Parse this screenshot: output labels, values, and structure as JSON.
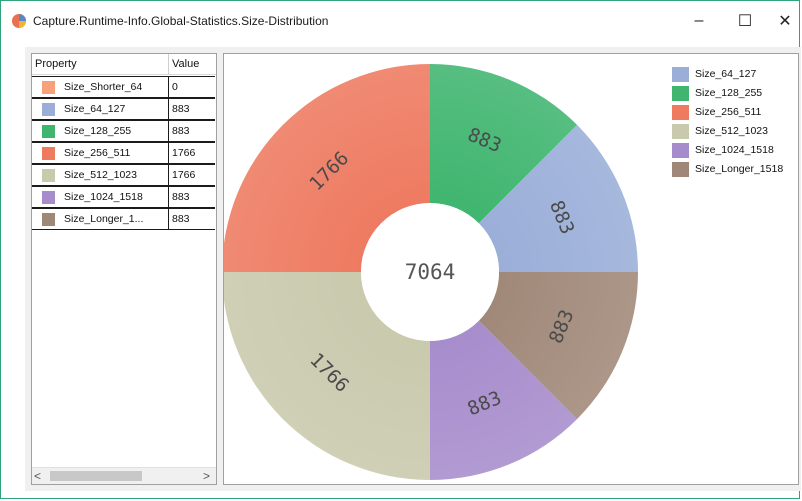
{
  "window": {
    "title": "Capture.Runtime-Info.Global-Statistics.Size-Distribution",
    "minimize_glyph": "–",
    "maximize_glyph": "☐",
    "close_glyph": "✕",
    "app_icon": "pie-chart-icon"
  },
  "grid": {
    "header_property": "Property",
    "header_value": "Value",
    "rows": [
      {
        "name": "Size_Shorter_64",
        "value": "0",
        "color": "#f7a07c"
      },
      {
        "name": "Size_64_127",
        "value": "883",
        "color": "#9aaed8"
      },
      {
        "name": "Size_128_255",
        "value": "883",
        "color": "#3fb56f"
      },
      {
        "name": "Size_256_511",
        "value": "1766",
        "color": "#ee7a60"
      },
      {
        "name": "Size_512_1023",
        "value": "1766",
        "color": "#c9c9ad"
      },
      {
        "name": "Size_1024_1518",
        "value": "883",
        "color": "#a78ccc"
      },
      {
        "name": "Size_Longer_1...",
        "value": "883",
        "color": "#a08878"
      }
    ],
    "scroll_left": "<",
    "scroll_right": ">"
  },
  "chart_data": {
    "type": "pie",
    "donut": true,
    "center_label": "7064",
    "start": "top, clockwise",
    "slices": [
      {
        "label": "Size_128_255",
        "value": 883,
        "color": "#3fb56f"
      },
      {
        "label": "Size_64_127",
        "value": 883,
        "color": "#9aaed8"
      },
      {
        "label": "Size_Longer_1518",
        "value": 883,
        "color": "#a08878"
      },
      {
        "label": "Size_1024_1518",
        "value": 883,
        "color": "#a78ccc"
      },
      {
        "label": "Size_512_1023",
        "value": 1766,
        "color": "#c9c9ad"
      },
      {
        "label": "Size_256_511",
        "value": 1766,
        "color": "#ee7a60"
      }
    ],
    "legend_placement": "top-right",
    "legend": [
      {
        "label": "Size_64_127",
        "color": "#9aaed8"
      },
      {
        "label": "Size_128_255",
        "color": "#3fb56f"
      },
      {
        "label": "Size_256_511",
        "color": "#ee7a60"
      },
      {
        "label": "Size_512_1023",
        "color": "#c9c9ad"
      },
      {
        "label": "Size_1024_1518",
        "color": "#a78ccc"
      },
      {
        "label": "Size_Longer_1518",
        "color": "#a08878"
      }
    ]
  }
}
